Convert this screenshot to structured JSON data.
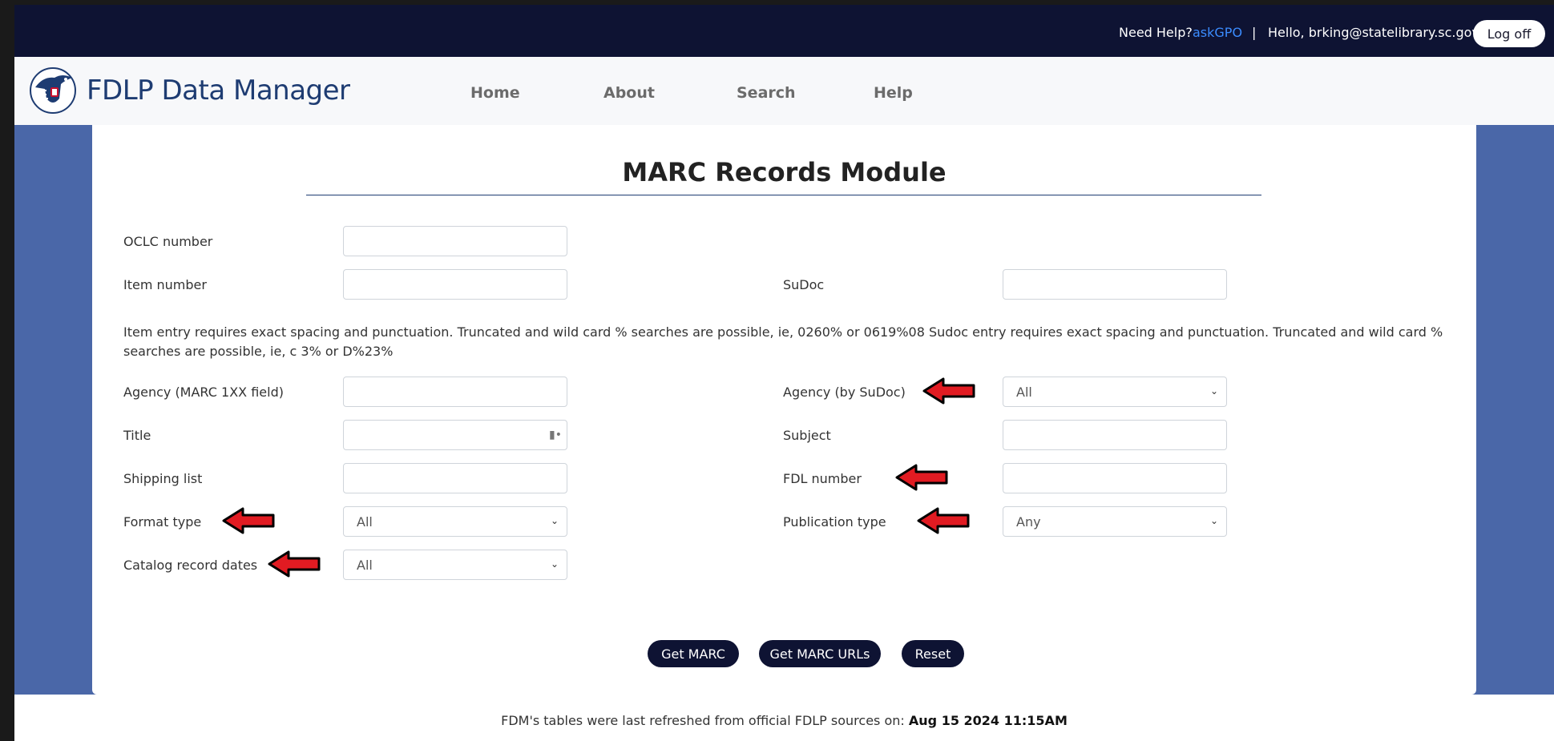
{
  "topbar": {
    "help_text": "Need Help?",
    "help_link": "askGPO",
    "separator": "|",
    "greeting": "Hello, brking@statelibrary.sc.gov !",
    "logoff_label": "Log off"
  },
  "brand": {
    "name": "FDLP Data Manager"
  },
  "nav": {
    "items": [
      "Home",
      "About",
      "Search",
      "Help"
    ]
  },
  "form": {
    "title": "MARC Records Module",
    "fields": {
      "oclc": {
        "label": "OCLC number",
        "value": ""
      },
      "item": {
        "label": "Item number",
        "value": ""
      },
      "sudoc": {
        "label": "SuDoc",
        "value": ""
      },
      "agency_marc": {
        "label": "Agency (MARC 1XX field)",
        "value": ""
      },
      "agency_sudoc": {
        "label": "Agency (by SuDoc)",
        "selected": "All"
      },
      "title": {
        "label": "Title",
        "value": ""
      },
      "subject": {
        "label": "Subject",
        "value": ""
      },
      "shipping": {
        "label": "Shipping list",
        "value": ""
      },
      "fdl": {
        "label": "FDL number",
        "value": ""
      },
      "format": {
        "label": "Format type",
        "selected": "All"
      },
      "publication": {
        "label": "Publication type",
        "selected": "Any"
      },
      "catalog_dates": {
        "label": "Catalog record dates",
        "selected": "All"
      }
    },
    "note": "Item entry requires exact spacing and punctuation. Truncated and wild card % searches are possible, ie, 0260% or 0619%08 Sudoc entry requires exact spacing and punctuation. Truncated and wild card % searches are possible, ie, c 3% or D%23%",
    "buttons": {
      "get_marc": "Get MARC",
      "get_marc_urls": "Get MARC URLs",
      "reset": "Reset"
    }
  },
  "footer": {
    "text": "FDM's tables were last refreshed from official FDLP sources on:",
    "date": "Aug 15 2024 11:15AM"
  },
  "colors": {
    "topbar_bg": "#0e1333",
    "page_bg": "#4a67a8",
    "link": "#3b8cff",
    "brand": "#1e3c72",
    "annotation_arrow": "#e11b22"
  }
}
